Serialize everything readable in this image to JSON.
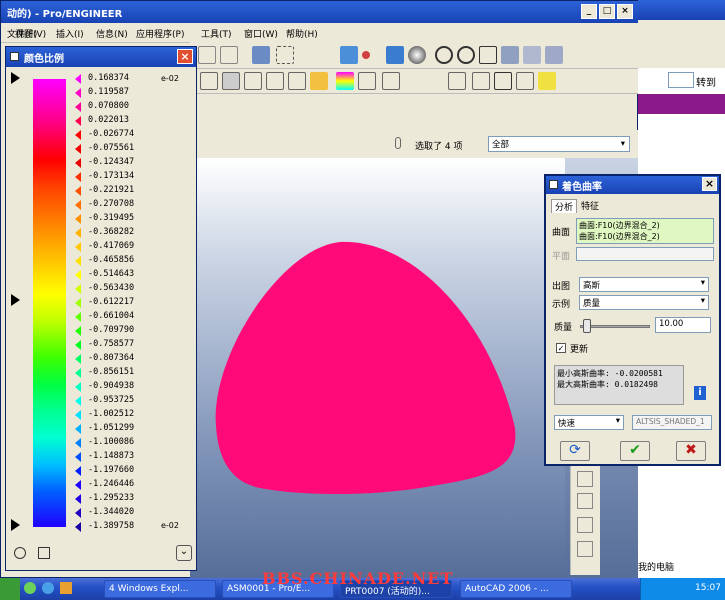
{
  "window": {
    "title": "动的) - Pro/ENGINEER",
    "controls": [
      "_",
      "□",
      "×"
    ]
  },
  "menubar": [
    "文件(F)",
    "视图(V)",
    "插入(I)",
    "信息(N)",
    "应用程序(P)",
    "工具(T)",
    "窗口(W)",
    "帮助(H)"
  ],
  "filter": {
    "selected_text": "选取了 4 项",
    "dropdown_value": "全部"
  },
  "browser": {
    "go_label": "转到",
    "computer_label": "我的电脑"
  },
  "color_scale": {
    "title": "颜色比例",
    "exponent_top": "e-02",
    "exponent_bottom": "e-02",
    "values": [
      "0.168374",
      "0.119587",
      "0.070800",
      "0.022013",
      "-0.026774",
      "-0.075561",
      "-0.124347",
      "-0.173134",
      "-0.221921",
      "-0.270708",
      "-0.319495",
      "-0.368282",
      "-0.417069",
      "-0.465856",
      "-0.514643",
      "-0.563430",
      "-0.612217",
      "-0.661004",
      "-0.709790",
      "-0.758577",
      "-0.807364",
      "-0.856151",
      "-0.904938",
      "-0.953725",
      "-1.002512",
      "-1.051299",
      "-1.100086",
      "-1.148873",
      "-1.197660",
      "-1.246446",
      "-1.295233",
      "-1.344020",
      "-1.389758"
    ],
    "colors": [
      "#ff00ff",
      "#ff00c8",
      "#ff0096",
      "#ff0050",
      "#ff0000",
      "#f00000",
      "#e80000",
      "#ff3000",
      "#ff5000",
      "#ff7000",
      "#ff9000",
      "#ffb000",
      "#ffc800",
      "#ffe000",
      "#ffff00",
      "#d0ff00",
      "#a0ff00",
      "#60ff00",
      "#20ff00",
      "#00ff20",
      "#00ff60",
      "#00ff90",
      "#00ffc0",
      "#00ffe8",
      "#00e0ff",
      "#00b0ff",
      "#0080ff",
      "#0050ff",
      "#0020ff",
      "#2000ff",
      "#2000e0",
      "#2000c0",
      "#1800a0"
    ]
  },
  "shading_dialog": {
    "title": "着色曲率",
    "tabs": [
      "分析",
      "特征"
    ],
    "surface_label": "曲面",
    "surfaces": [
      "曲面:F10(边界混合_2)",
      "曲面:F10(边界混合_2)"
    ],
    "plane_label": "平面",
    "output_label": "出图",
    "output_value": "高斯",
    "example_label": "示例",
    "example_value": "质量",
    "quality_label": "质量",
    "quality_value": "10.00",
    "quality_level": 0.05,
    "update_label": "更新",
    "update_checked": true,
    "result_min": "最小高斯曲率: -0.0200581",
    "result_max": "最大高斯曲率: 0.0182498",
    "mode_value": "快速",
    "name_value": "ALTSIS_SHADED_1"
  },
  "model": {
    "color": "#ff0a78"
  },
  "taskbar": {
    "tasks": [
      "4 Windows Expl...",
      "ASM0001 - Pro/E...",
      "PRT0007 (活动的)...",
      "AutoCAD 2006 - ..."
    ],
    "watermark": "BBS.CHINADE.NET",
    "clock": "15:07"
  }
}
